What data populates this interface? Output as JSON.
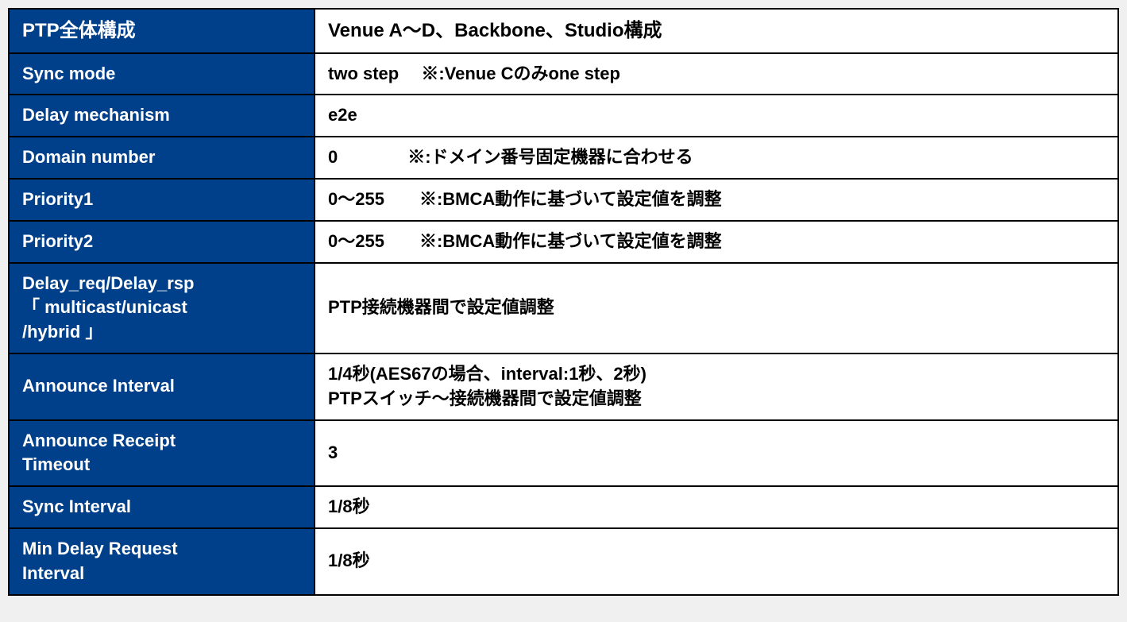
{
  "table": {
    "rows": [
      {
        "id": "ptp-overall",
        "label": "PTP全体構成",
        "value": "Venue A～D、Backbone、Studio構成",
        "isHeader": true
      },
      {
        "id": "sync-mode",
        "label": "Sync mode",
        "value": "two step　 ※:Venue Cのみone step",
        "isHeader": false
      },
      {
        "id": "delay-mechanism",
        "label": "Delay mechanism",
        "value": "e2e",
        "isHeader": false
      },
      {
        "id": "domain-number",
        "label": "Domain number",
        "value": "0　　　　※:ドメイン番号固定機器に合わせる",
        "isHeader": false
      },
      {
        "id": "priority1",
        "label": "Priority1",
        "value": "0～255　　※:BMCA動作に基づいて設定値を調整",
        "isHeader": false
      },
      {
        "id": "priority2",
        "label": "Priority2",
        "value": "0～255　　※:BMCA動作に基づいて設定値を調整",
        "isHeader": false
      },
      {
        "id": "delay-req-rsp",
        "label": "Delay_req/Delay_rsp\n「 multicast/unicast\n /hybrid 」",
        "value": "PTP接続機器間で設定値調整",
        "isHeader": false
      },
      {
        "id": "announce-interval",
        "label": "Announce Interval",
        "value": "1/4秒(AES67の場合、interval:1秒、2秒)\nPTPスイッチ～接続機器間で設定値調整",
        "isHeader": false
      },
      {
        "id": "announce-receipt-timeout",
        "label": "Announce Receipt\nTimeout",
        "value": "3",
        "isHeader": false
      },
      {
        "id": "sync-interval",
        "label": "Sync Interval",
        "value": "1/8秒",
        "isHeader": false
      },
      {
        "id": "min-delay-request-interval",
        "label": "Min Delay Request\nInterval",
        "value": "1/8秒",
        "isHeader": false
      }
    ]
  }
}
